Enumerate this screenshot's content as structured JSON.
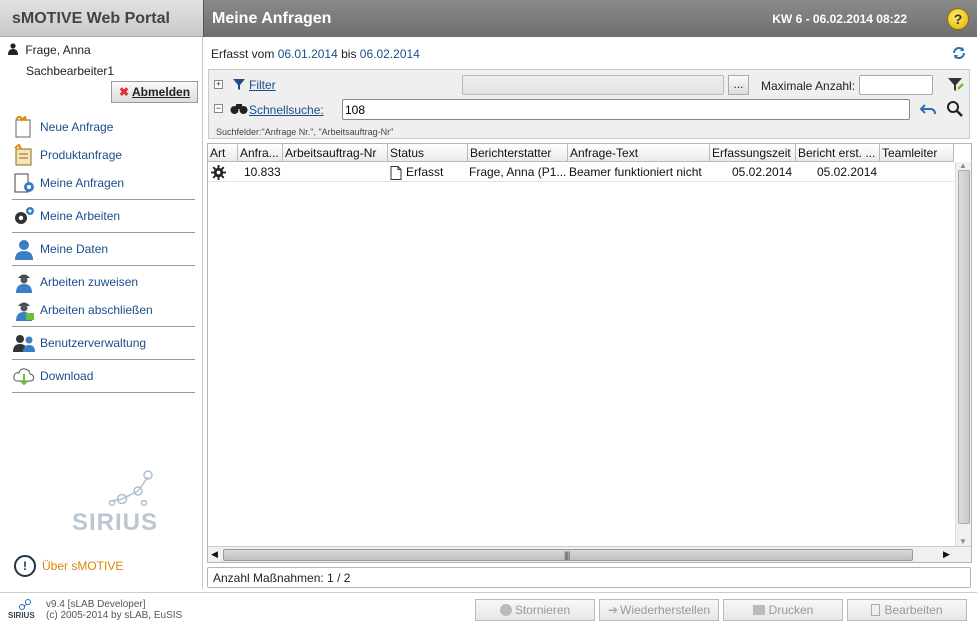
{
  "app": {
    "brand": "sMOTIVE Web Portal",
    "page_title": "Meine Anfragen",
    "datetime": "KW 6 - 06.02.2014 08:22",
    "help_glyph": "?"
  },
  "user": {
    "name": "Frage, Anna",
    "role": "Sachbearbeiter1",
    "logout_label": "Abmelden"
  },
  "sidebar": {
    "items": [
      {
        "label": "Neue Anfrage",
        "icon": "new-request-icon"
      },
      {
        "label": "Produktanfrage",
        "icon": "product-request-icon"
      },
      {
        "label": "Meine Anfragen",
        "icon": "my-requests-icon"
      },
      {
        "label": "Meine Arbeiten",
        "icon": "gears-icon"
      },
      {
        "label": "Meine Daten",
        "icon": "user-data-icon"
      },
      {
        "label": "Arbeiten zuweisen",
        "icon": "worker-assign-icon"
      },
      {
        "label": "Arbeiten abschließen",
        "icon": "worker-complete-icon"
      },
      {
        "label": "Benutzerverwaltung",
        "icon": "users-icon"
      },
      {
        "label": "Download",
        "icon": "cloud-download-icon"
      }
    ],
    "logo_text": "SIRIUS",
    "about_label": "Über sMOTIVE"
  },
  "range": {
    "prefix": "Erfasst vom",
    "from": "06.01.2014",
    "middle": "bis",
    "to": "06.02.2014"
  },
  "filter": {
    "filter_label": "Filter",
    "dots_label": "...",
    "max_label": "Maximale Anzahl:",
    "max_value": "",
    "quick_label": "Schnellsuche:",
    "quick_value": "108",
    "hint": "Suchfelder:\"Anfrage Nr.\", \"Arbeitsauftrag-Nr\""
  },
  "grid": {
    "columns": [
      "Art",
      "Anfra...",
      "Arbeitsauftrag-Nr",
      "Status",
      "Berichterstatter",
      "Anfrage-Text",
      "Erfassungszeit",
      "Bericht erst. ...",
      "Teamleiter"
    ],
    "rows": [
      {
        "art_icon": "gear-icon",
        "anfrage": "10.833",
        "auftrag": "",
        "status": "Erfasst",
        "berichterstatter": "Frage, Anna (P1...",
        "text": "Beamer funktioniert nicht",
        "erfassung": "05.02.2014",
        "bericht": "05.02.2014",
        "teamleiter": ""
      }
    ]
  },
  "status": {
    "count_label": "Anzahl Maßnahmen: 1 / 2"
  },
  "footer": {
    "version_line1": "v9.4 [sLAB Developer]",
    "version_line2": "(c) 2005-2014 by sLAB, EuSIS",
    "logo_text": "SIRIUS",
    "buttons": {
      "cancel": "Stornieren",
      "restore": "Wiederherstellen",
      "print": "Drucken",
      "edit": "Bearbeiten"
    }
  }
}
